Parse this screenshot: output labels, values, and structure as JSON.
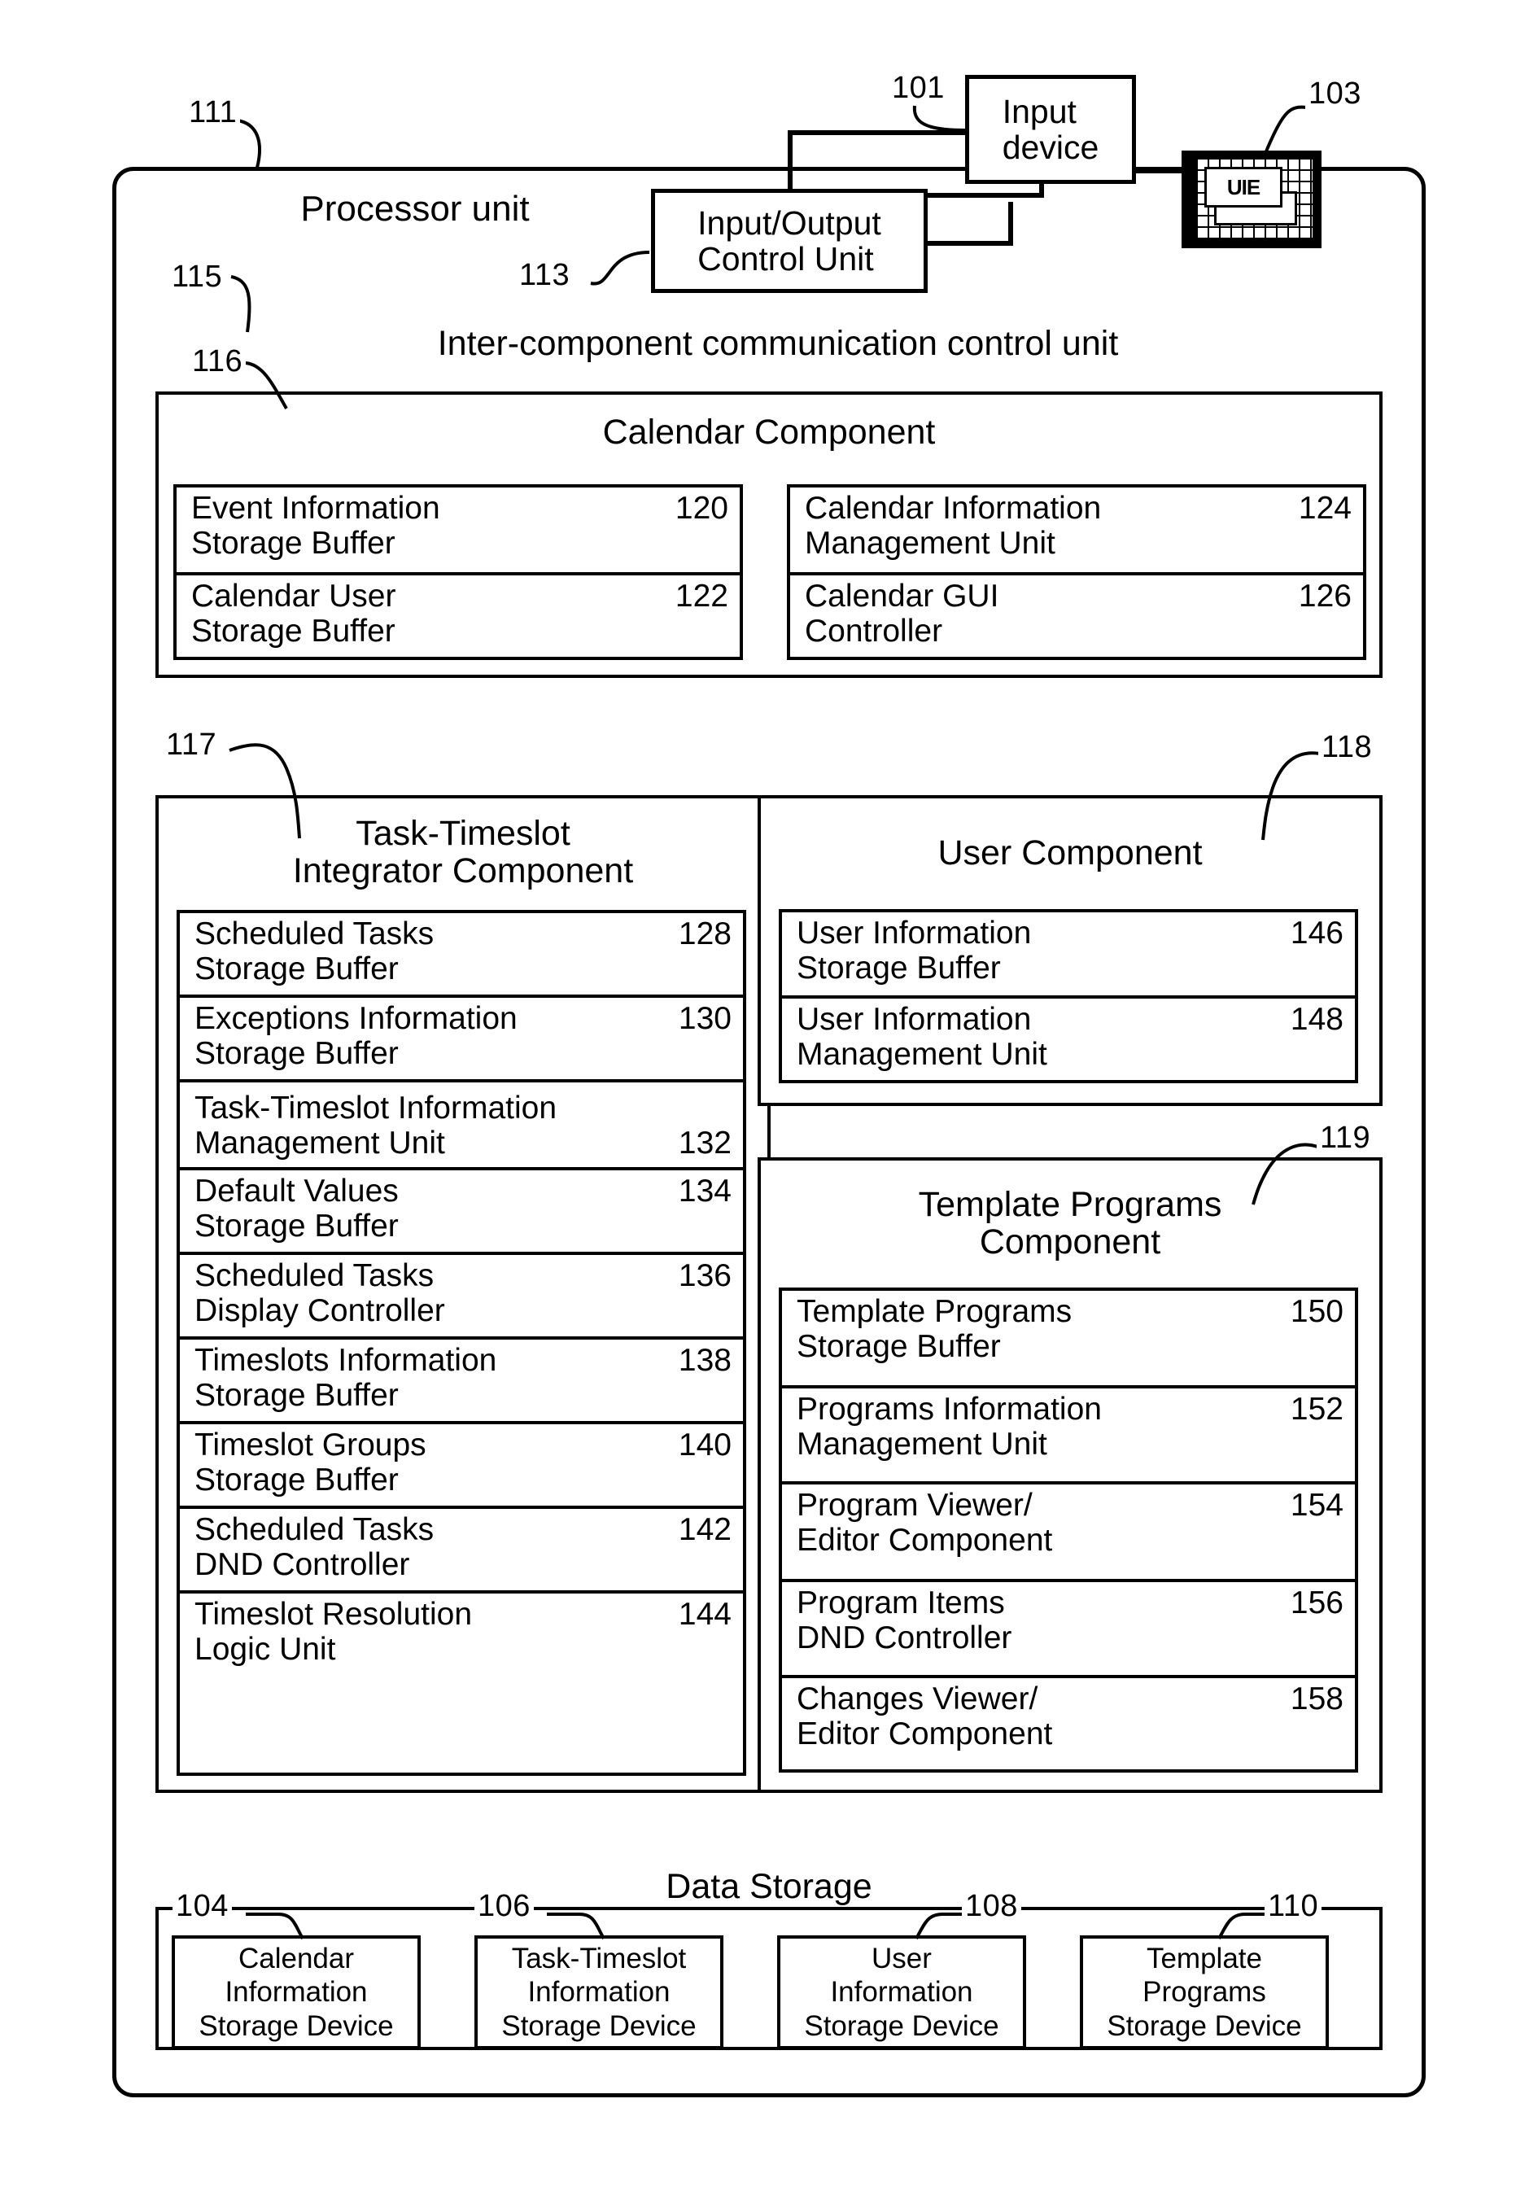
{
  "figure": {
    "processor_unit": {
      "label": "Processor unit",
      "ref": "111"
    },
    "input_device": {
      "label": "Input\ndevice",
      "ref": "101"
    },
    "io_control_unit": {
      "label": "Input/Output\nControl Unit",
      "ref": "113"
    },
    "uie_display": {
      "label": "UIE",
      "ref": "103"
    },
    "inter_component_bus": {
      "label": "Inter-component communication control unit",
      "ref": "115"
    },
    "calendar_component": {
      "title": "Calendar Component",
      "ref": "116",
      "items_left": [
        {
          "label": "Event Information\nStorage Buffer",
          "num": "120"
        },
        {
          "label": "Calendar User\nStorage Buffer",
          "num": "122"
        }
      ],
      "items_right": [
        {
          "label": "Calendar Information\nManagement Unit",
          "num": "124"
        },
        {
          "label": "Calendar GUI\nController",
          "num": "126"
        }
      ]
    },
    "task_timeslot_component": {
      "title": "Task-Timeslot\nIntegrator Component",
      "ref": "117",
      "items": [
        {
          "label": "Scheduled Tasks\nStorage Buffer",
          "num": "128",
          "num_position": "top"
        },
        {
          "label": "Exceptions Information\nStorage Buffer",
          "num": "130",
          "num_position": "top"
        },
        {
          "label": "Task-Timeslot Information\nManagement Unit",
          "num": "132",
          "num_position": "bottom"
        },
        {
          "label": "Default Values\nStorage Buffer",
          "num": "134",
          "num_position": "top"
        },
        {
          "label": "Scheduled Tasks\nDisplay Controller",
          "num": "136",
          "num_position": "top"
        },
        {
          "label": "Timeslots Information\nStorage Buffer",
          "num": "138",
          "num_position": "top"
        },
        {
          "label": "Timeslot Groups\nStorage Buffer",
          "num": "140",
          "num_position": "top"
        },
        {
          "label": "Scheduled Tasks\nDND Controller",
          "num": "142",
          "num_position": "top"
        },
        {
          "label": "Timeslot Resolution\nLogic Unit",
          "num": "144",
          "num_position": "top"
        }
      ]
    },
    "user_component": {
      "title": "User Component",
      "ref": "118",
      "items": [
        {
          "label": "User Information\nStorage Buffer",
          "num": "146"
        },
        {
          "label": "User Information\nManagement Unit",
          "num": "148"
        }
      ]
    },
    "template_programs_component": {
      "title": "Template Programs\nComponent",
      "ref": "119",
      "items": [
        {
          "label": "Template Programs\nStorage Buffer",
          "num": "150"
        },
        {
          "label": "Programs Information\nManagement Unit",
          "num": "152"
        },
        {
          "label": "Program Viewer/\nEditor Component",
          "num": "154"
        },
        {
          "label": "Program Items\nDND Controller",
          "num": "156"
        },
        {
          "label": "Changes Viewer/\nEditor Component",
          "num": "158"
        }
      ]
    },
    "data_storage": {
      "title": "Data Storage",
      "devices": [
        {
          "label": "Calendar\nInformation\nStorage Device",
          "num": "104"
        },
        {
          "label": "Task-Timeslot\nInformation\nStorage Device",
          "num": "106"
        },
        {
          "label": "User\nInformation\nStorage Device",
          "num": "108"
        },
        {
          "label": "Template\nPrograms\nStorage Device",
          "num": "110"
        }
      ]
    }
  },
  "colors": {
    "ink": "#000000",
    "paper": "#ffffff"
  }
}
